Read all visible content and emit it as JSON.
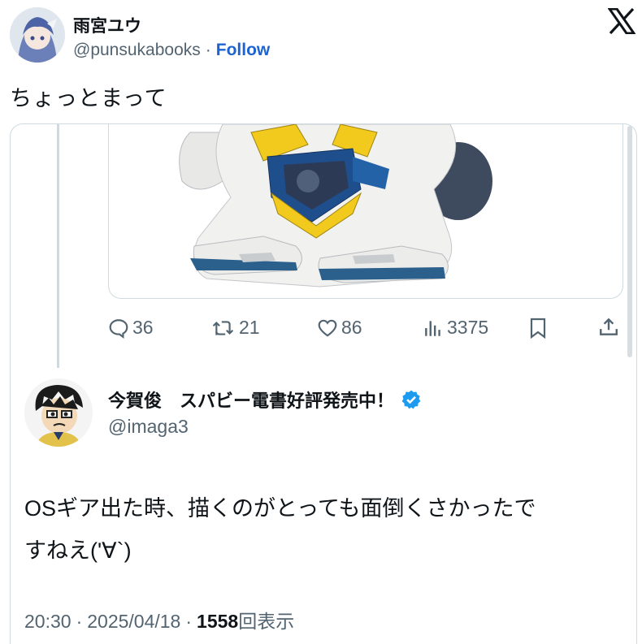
{
  "author": {
    "name": "雨宮ユウ",
    "handle": "@punsukabooks",
    "separator": "·",
    "follow_label": "Follow"
  },
  "logo_icon": "x-logo-icon",
  "tweet_text": "ちょっとまって",
  "embedded_actions": {
    "replies": "36",
    "retweets": "21",
    "likes": "86",
    "views": "3375"
  },
  "reply": {
    "name": "今賀俊　スパビー電書好評発売中！",
    "handle": "@imaga3",
    "verified": true,
    "text_line1": "OSギア出た時、描くのがとっても面倒くさかったで",
    "text_line2": "すねえ('∀`)"
  },
  "meta": {
    "time": "20:30",
    "sep1": "·",
    "date": "2025/04/18",
    "sep2": "·",
    "views_count": "1558",
    "views_label": "回表示"
  },
  "colors": {
    "link": "#1d63d3",
    "verified": "#1d9bf0",
    "muted": "#536471"
  }
}
